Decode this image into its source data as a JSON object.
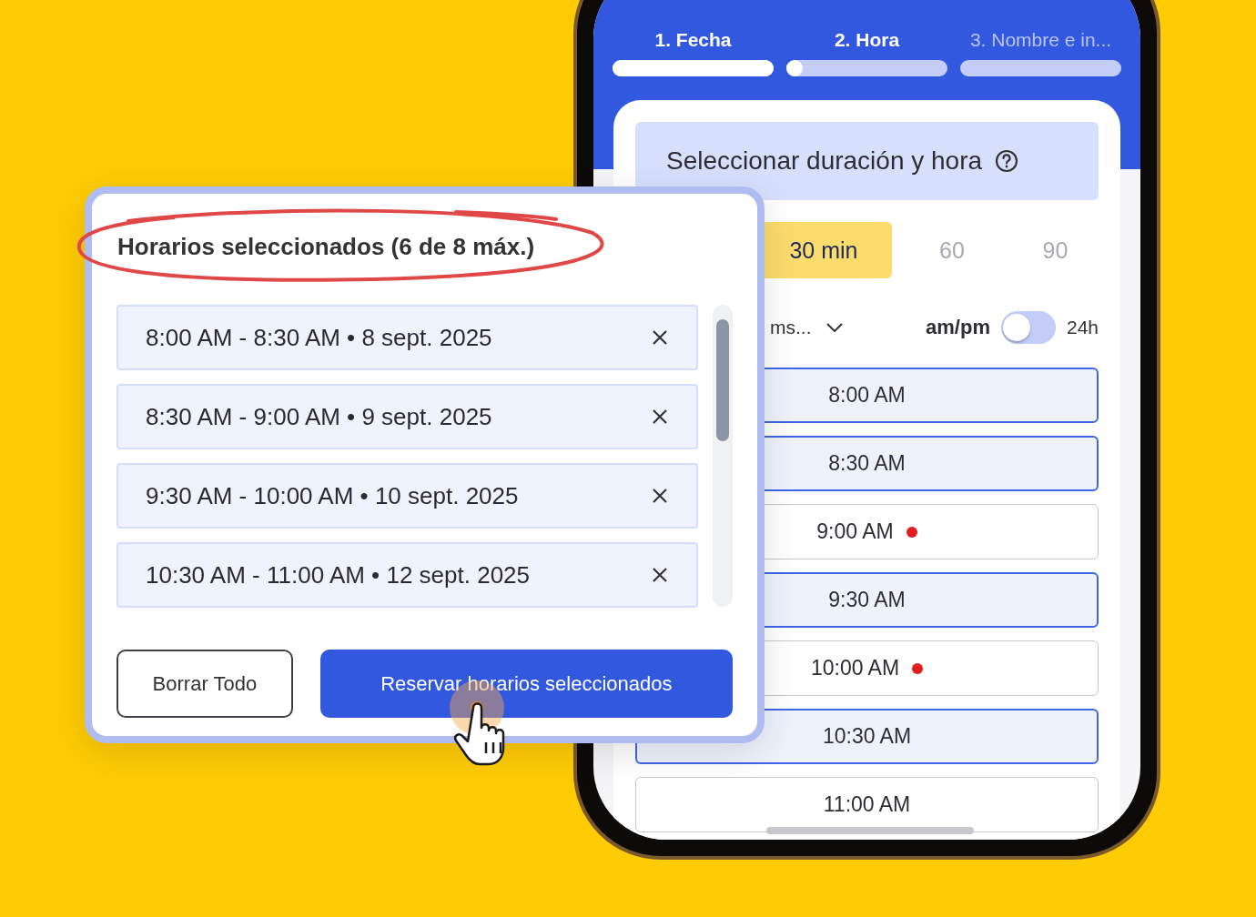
{
  "steps": [
    {
      "label": "1. Fecha",
      "active": true,
      "level": 1
    },
    {
      "label": "2. Hora",
      "active": true,
      "level": 0.05
    },
    {
      "label": "3. Nombre e in...",
      "active": false,
      "level": 0
    }
  ],
  "panel_title": "Seleccionar duración y hora",
  "durations": [
    {
      "label": "30 min",
      "selected": true
    },
    {
      "label": "60",
      "selected": false
    },
    {
      "label": "90",
      "selected": false
    }
  ],
  "timezone": {
    "value": "ms..."
  },
  "clock_format": {
    "label_left": "am/pm",
    "label_right": "24h",
    "on": false
  },
  "slots": [
    {
      "time": "8:00 AM",
      "selected": true,
      "marked": false
    },
    {
      "time": "8:30 AM",
      "selected": true,
      "marked": false
    },
    {
      "time": "9:00 AM",
      "selected": false,
      "marked": true
    },
    {
      "time": "9:30 AM",
      "selected": true,
      "marked": false
    },
    {
      "time": "10:00 AM",
      "selected": false,
      "marked": true
    },
    {
      "time": "10:30 AM",
      "selected": true,
      "marked": false
    },
    {
      "time": "11:00 AM",
      "selected": false,
      "marked": false
    }
  ],
  "selected_card": {
    "title": "Horarios seleccionados (6 de 8 máx.)",
    "items": [
      {
        "text": "8:00 AM - 8:30 AM • 8 sept. 2025"
      },
      {
        "text": "8:30 AM - 9:00 AM • 9 sept. 2025"
      },
      {
        "text": "9:30 AM - 10:00 AM • 10 sept. 2025"
      },
      {
        "text": "10:30 AM - 11:00 AM • 12 sept. 2025"
      }
    ],
    "clear_button": "Borrar Todo",
    "submit_button": "Reservar horarios seleccionados"
  }
}
